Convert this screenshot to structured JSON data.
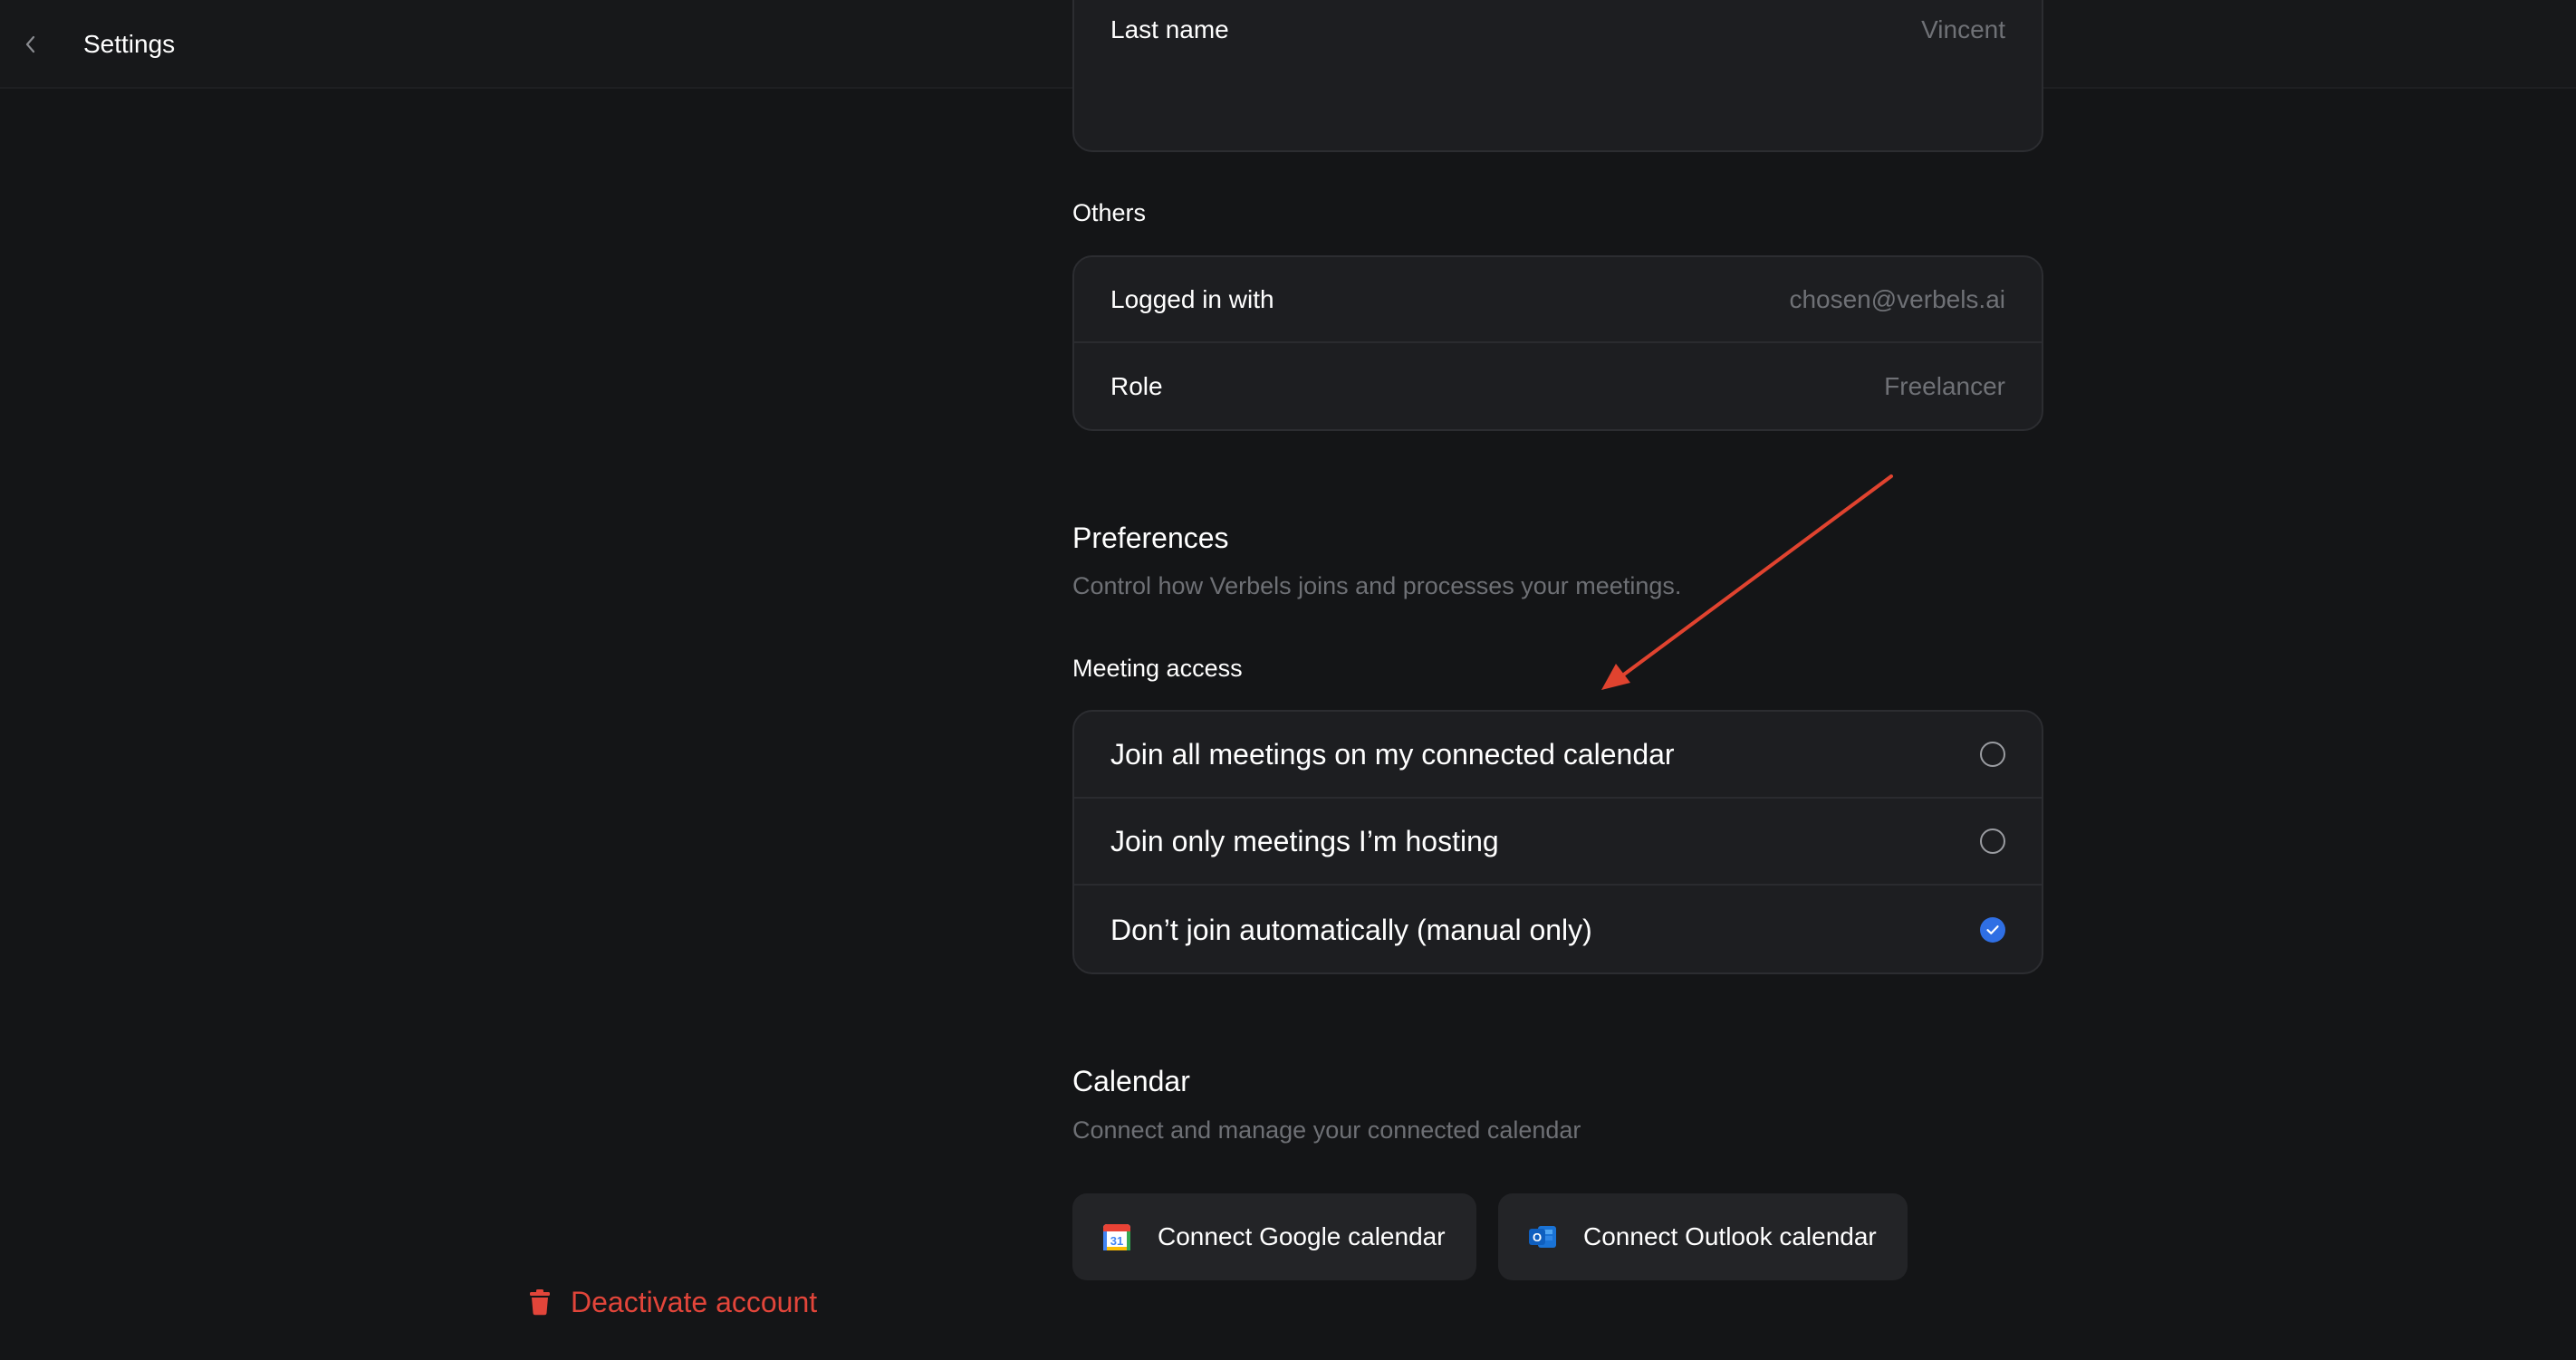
{
  "header": {
    "title": "Settings",
    "back_icon": "chevron-left-icon"
  },
  "profile": {
    "last_name_label": "Last name",
    "last_name_value": "Vincent"
  },
  "others": {
    "section_label": "Others",
    "rows": [
      {
        "label": "Logged in with",
        "value": "chosen@verbels.ai"
      },
      {
        "label": "Role",
        "value": "Freelancer"
      }
    ]
  },
  "preferences": {
    "heading": "Preferences",
    "subtitle": "Control how Verbels joins and processes your meetings.",
    "meeting_access_label": "Meeting access",
    "options": [
      {
        "label": "Join all meetings on my connected calendar",
        "selected": false
      },
      {
        "label": "Join only meetings I’m hosting",
        "selected": false
      },
      {
        "label": "Don’t join automatically (manual only)",
        "selected": true
      }
    ]
  },
  "calendar": {
    "heading": "Calendar",
    "subtitle": "Connect and manage your connected calendar",
    "google_button": "Connect Google calendar",
    "outlook_button": "Connect Outlook calendar",
    "google_icon_text": "31",
    "outlook_icon_text": "O"
  },
  "account": {
    "deactivate_label": "Deactivate account"
  },
  "colors": {
    "background": "#141517",
    "card": "#1d1e21",
    "accent_blue": "#2f6fe4",
    "danger_red": "#e2453a",
    "annotation_arrow": "#e0432f"
  }
}
